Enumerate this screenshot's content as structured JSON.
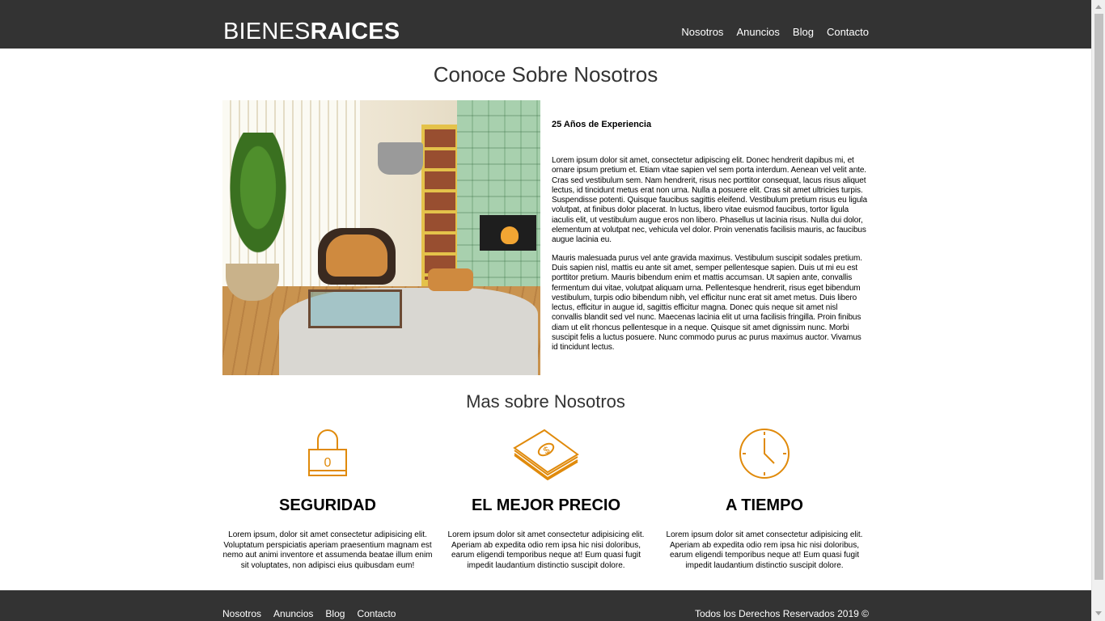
{
  "header": {
    "logo_light": "BIENES",
    "logo_bold": "RAICES",
    "nav": [
      "Nosotros",
      "Anuncios",
      "Blog",
      "Contacto"
    ]
  },
  "about": {
    "title": "Conoce Sobre Nosotros",
    "heading": "25 Años de Experiencia",
    "paragraph1": "Lorem ipsum dolor sit amet, consectetur adipiscing elit. Donec hendrerit dapibus mi, et ornare ipsum pretium et. Etiam vitae sapien vel sem porta interdum. Aenean vel velit ante. Cras sed vestibulum sem. Nam hendrerit, risus nec porttitor consequat, lacus risus aliquet lectus, id tincidunt metus erat non urna. Nulla a posuere elit. Cras sit amet ultricies turpis. Suspendisse potenti. Quisque faucibus sagittis eleifend. Vestibulum pretium risus eu ligula volutpat, at finibus dolor placerat. In luctus, libero vitae euismod faucibus, tortor ligula iaculis elit, ut vestibulum augue eros non libero. Phasellus ut lacinia risus. Nulla dui dolor, elementum at volutpat nec, vehicula vel dolor. Proin venenatis facilisis mauris, ac faucibus augue lacinia eu.",
    "paragraph2": "Mauris malesuada purus vel ante gravida maximus. Vestibulum suscipit sodales pretium. Duis sapien nisl, mattis eu ante sit amet, semper pellentesque sapien. Duis ut mi eu est porttitor pretium. Mauris bibendum enim et mattis accumsan. Ut sapien ante, convallis fermentum dui vitae, volutpat aliquam urna. Pellentesque hendrerit, risus eget bibendum vestibulum, turpis odio bibendum nibh, vel efficitur nunc erat sit amet metus. Duis libero lectus, efficitur in augue id, sagittis efficitur magna. Donec quis neque sit amet nisl convallis blandit sed vel nunc. Maecenas lacinia elit ut urna facilisis fringilla. Proin finibus diam ut elit rhoncus pellentesque in a neque. Quisque sit amet dignissim nunc. Morbi suscipit felis a luctus posuere. Nunc commodo purus ac purus maximus auctor. Vivamus id tincidunt lectus."
  },
  "more": {
    "title": "Mas sobre Nosotros",
    "features": [
      {
        "icon": "padlock-icon",
        "title": "SEGURIDAD",
        "text": "Lorem ipsum, dolor sit amet consectetur adipisicing elit. Voluptatum perspiciatis aperiam praesentium magnam est nemo aut animi inventore et assumenda beatae illum enim sit voluptates, non adipisci eius quibusdam eum!"
      },
      {
        "icon": "money-stack-icon",
        "title": "EL MEJOR PRECIO",
        "text": "Lorem ipsum dolor sit amet consectetur adipisicing elit. Aperiam ab expedita odio rem ipsa hic nisi doloribus, earum eligendi temporibus neque at! Eum quasi fugit impedit laudantium distinctio suscipit dolore."
      },
      {
        "icon": "clock-icon",
        "title": "A TIEMPO",
        "text": "Lorem ipsum dolor sit amet consectetur adipisicing elit. Aperiam ab expedita odio rem ipsa hic nisi doloribus, earum eligendi temporibus neque at! Eum quasi fugit impedit laudantium distinctio suscipit dolore."
      }
    ]
  },
  "footer": {
    "nav": [
      "Nosotros",
      "Anuncios",
      "Blog",
      "Contacto"
    ],
    "copyright": "Todos los Derechos Reservados 2019 ©"
  },
  "colors": {
    "header_bg": "#333333",
    "accent": "#e08a0b",
    "text": "#000000"
  }
}
